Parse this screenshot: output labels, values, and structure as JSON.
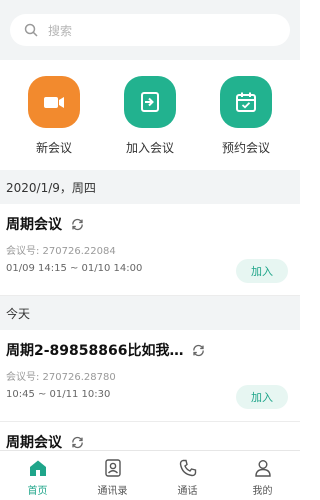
{
  "search": {
    "placeholder": "搜索"
  },
  "actions": [
    {
      "label": "新会议",
      "color": "#f28a2e",
      "icon": "video-camera-icon"
    },
    {
      "label": "加入会议",
      "color": "#22b28f",
      "icon": "enter-icon"
    },
    {
      "label": "预约会议",
      "color": "#22b28f",
      "icon": "calendar-icon"
    }
  ],
  "sections": {
    "date1": "2020/1/9，周四",
    "date2": "今天"
  },
  "meetings": [
    {
      "title": "周期会议",
      "meeting_id": "会议号: 270726.22084",
      "time": "01/09 14:15 ~ 01/10 14:00",
      "join_label": "加入"
    },
    {
      "title": "周期2-89858866比如我…",
      "meeting_id": "会议号: 270726.28780",
      "time": "10:45 ~ 01/11 10:30",
      "join_label": "加入"
    },
    {
      "title": "周期会议"
    }
  ],
  "tabs": [
    {
      "label": "首页",
      "icon": "home-icon",
      "active": true
    },
    {
      "label": "通讯录",
      "icon": "contacts-icon",
      "active": false
    },
    {
      "label": "通话",
      "icon": "phone-icon",
      "active": false
    },
    {
      "label": "我的",
      "icon": "profile-icon",
      "active": false
    }
  ],
  "colors": {
    "accent": "#1fa58a",
    "orange": "#f28a2e",
    "background": "#f2f4f5"
  }
}
